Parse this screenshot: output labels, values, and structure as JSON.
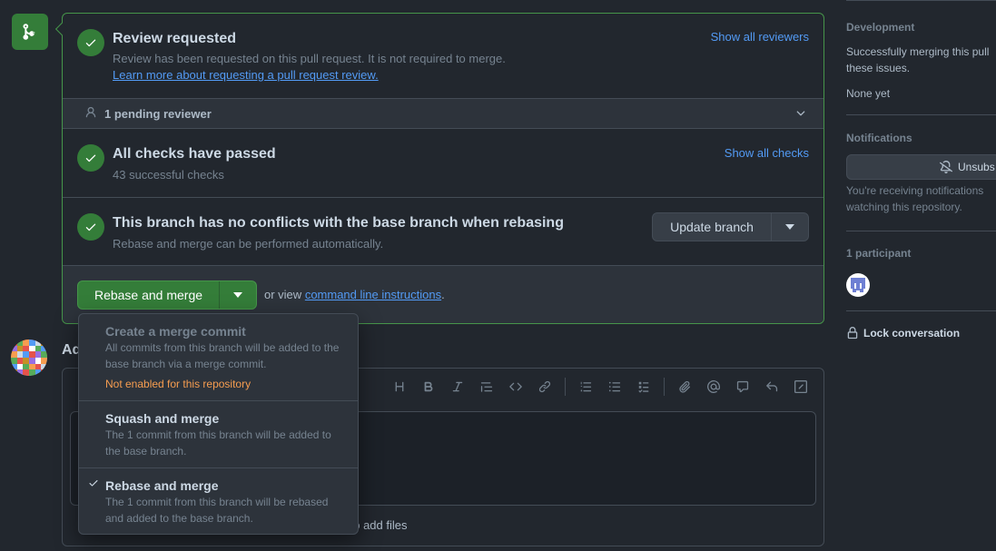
{
  "review": {
    "title": "Review requested",
    "subtitle": "Review has been requested on this pull request. It is not required to merge.",
    "learn_link": "Learn more about requesting a pull request review.",
    "show_link": "Show all reviewers",
    "pending": "1 pending reviewer"
  },
  "checks": {
    "title": "All checks have passed",
    "subtitle": "43 successful checks",
    "show_link": "Show all checks"
  },
  "conflicts": {
    "title": "This branch has no conflicts with the base branch when rebasing",
    "subtitle": "Rebase and merge can be performed automatically.",
    "update_button": "Update branch"
  },
  "merge": {
    "button_label": "Rebase and merge",
    "or_view": "or view",
    "cli_link": "command line instructions",
    "period": "."
  },
  "dropdown": {
    "items": [
      {
        "title": "Create a merge commit",
        "desc": "All commits from this branch will be added to the base branch via a merge commit.",
        "warning": "Not enabled for this repository",
        "selected": false,
        "disabled": true
      },
      {
        "title": "Squash and merge",
        "desc": "The 1 commit from this branch will be added to the base branch.",
        "selected": false,
        "disabled": false
      },
      {
        "title": "Rebase and merge",
        "desc": "The 1 commit from this branch will be rebased and added to the base branch.",
        "selected": true,
        "disabled": false
      }
    ]
  },
  "comment": {
    "heading": "Ad",
    "attach_text": "ck to add files"
  },
  "sidebar": {
    "development": {
      "heading": "Development",
      "text": "Successfully merging this pull these issues.",
      "none": "None yet"
    },
    "notifications": {
      "heading": "Notifications",
      "button": "Unsubs",
      "note": "You're receiving notifications watching this repository."
    },
    "participants": {
      "heading": "1 participant"
    },
    "lock": "Lock conversation"
  },
  "colors": {
    "accent_green": "#347d39",
    "link_blue": "#539bf5",
    "warning_orange": "#f69d50",
    "background": "#22272e"
  }
}
